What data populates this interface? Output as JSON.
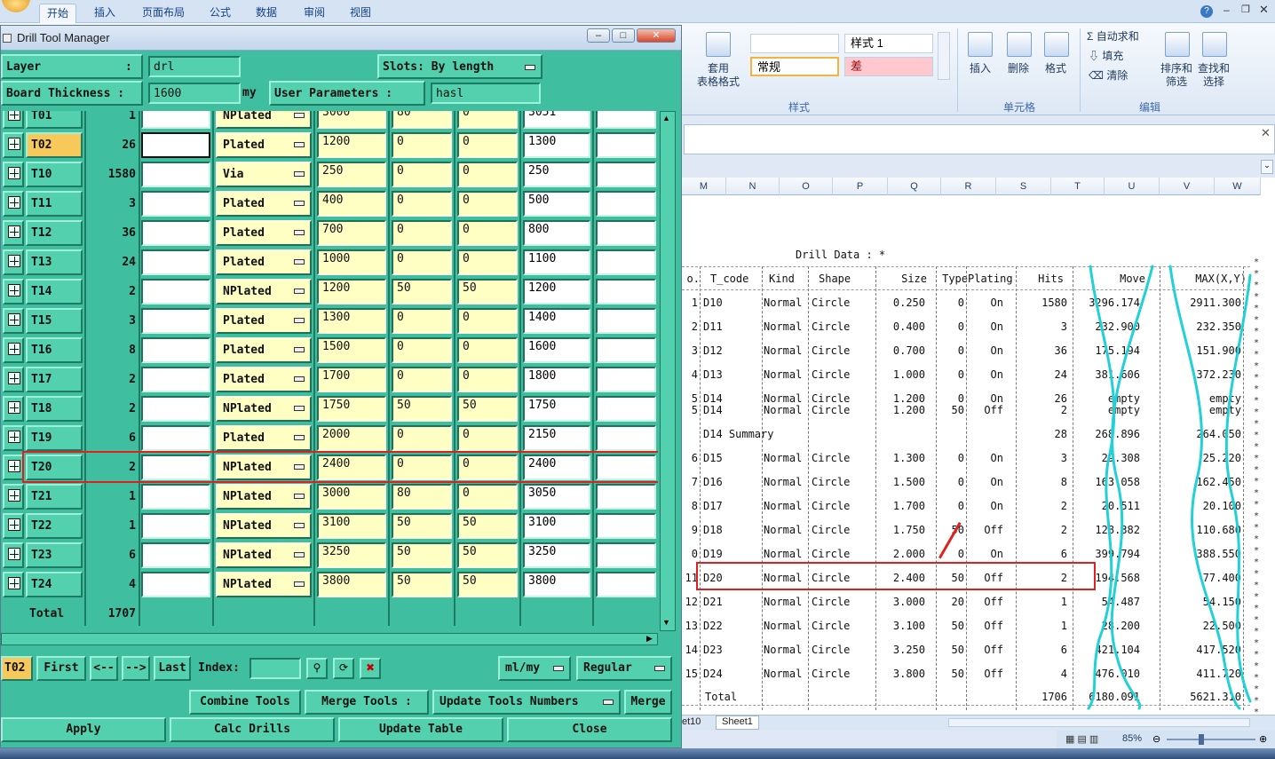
{
  "excel": {
    "tabs": [
      "开始",
      "插入",
      "页面布局",
      "公式",
      "数据",
      "审阅",
      "视图"
    ],
    "active_tab": "开始",
    "ribbon": {
      "style_labels": {
        "format_table": "套用\n表格格式",
        "style1": "样式 1",
        "normal": "常规",
        "bad": "差",
        "group_styles": "样式"
      },
      "cells_group": {
        "insert": "插入",
        "delete": "删除",
        "format": "格式",
        "label": "单元格"
      },
      "edit_group": {
        "autosum": "自动求和",
        "fill": "填充",
        "clear": "清除",
        "sort": "排序和\n筛选",
        "find": "查找和\n选择",
        "label": "编辑"
      }
    },
    "columns": [
      "M",
      "N",
      "O",
      "P",
      "Q",
      "R",
      "S",
      "T",
      "U",
      "V",
      "W"
    ],
    "sheet_tabs": [
      "et10",
      "Sheet1"
    ],
    "zoom": "85%",
    "drill_data": {
      "title": "Drill Data :  *",
      "headers": [
        "o.",
        "T_code",
        "Kind",
        "Shape",
        "Size",
        "Type",
        "Plating",
        "Hits",
        "Move",
        "MAX(X,Y)"
      ],
      "rows": [
        {
          "no": "1",
          "tcode": "D10",
          "kind": "Normal",
          "shape": "Circle",
          "size": "0.250",
          "type": "0",
          "plating": "On",
          "hits": "1580",
          "move": "3296.174",
          "max": "2911.300"
        },
        {
          "no": "2",
          "tcode": "D11",
          "kind": "Normal",
          "shape": "Circle",
          "size": "0.400",
          "type": "0",
          "plating": "On",
          "hits": "3",
          "move": "232.900",
          "max": "232.350"
        },
        {
          "no": "3",
          "tcode": "D12",
          "kind": "Normal",
          "shape": "Circle",
          "size": "0.700",
          "type": "0",
          "plating": "On",
          "hits": "36",
          "move": "175.194",
          "max": "151.900"
        },
        {
          "no": "4",
          "tcode": "D13",
          "kind": "Normal",
          "shape": "Circle",
          "size": "1.000",
          "type": "0",
          "plating": "On",
          "hits": "24",
          "move": "381.606",
          "max": "372.230"
        },
        {
          "no": "5",
          "tcode": "D14",
          "kind": "Normal",
          "shape": "Circle",
          "size": "1.200",
          "type": "0",
          "plating": "On",
          "hits": "26",
          "move": "empty",
          "max": "empty"
        },
        {
          "no": "5",
          "tcode": "D14",
          "kind": "Normal",
          "shape": "Circle",
          "size": "1.200",
          "type": "50",
          "plating": "Off",
          "hits": "2",
          "move": "empty",
          "max": "empty"
        },
        {
          "no": "",
          "tcode": "D14 Summary",
          "kind": "",
          "shape": "",
          "size": "",
          "type": "",
          "plating": "",
          "hits": "28",
          "move": "268.896",
          "max": "264.050"
        },
        {
          "no": "6",
          "tcode": "D15",
          "kind": "Normal",
          "shape": "Circle",
          "size": "1.300",
          "type": "0",
          "plating": "On",
          "hits": "3",
          "move": "29.308",
          "max": "25.220"
        },
        {
          "no": "7",
          "tcode": "D16",
          "kind": "Normal",
          "shape": "Circle",
          "size": "1.500",
          "type": "0",
          "plating": "On",
          "hits": "8",
          "move": "163.058",
          "max": "162.450"
        },
        {
          "no": "8",
          "tcode": "D17",
          "kind": "Normal",
          "shape": "Circle",
          "size": "1.700",
          "type": "0",
          "plating": "On",
          "hits": "2",
          "move": "20.511",
          "max": "20.100"
        },
        {
          "no": "9",
          "tcode": "D18",
          "kind": "Normal",
          "shape": "Circle",
          "size": "1.750",
          "type": "50",
          "plating": "Off",
          "hits": "2",
          "move": "128.382",
          "max": "110.680"
        },
        {
          "no": "0",
          "tcode": "D19",
          "kind": "Normal",
          "shape": "Circle",
          "size": "2.000",
          "type": "0",
          "plating": "On",
          "hits": "6",
          "move": "399.794",
          "max": "388.550"
        },
        {
          "no": "11",
          "tcode": "D20",
          "kind": "Normal",
          "shape": "Circle",
          "size": "2.400",
          "type": "50",
          "plating": "Off",
          "hits": "2",
          "move": "194.568",
          "max": "77.400"
        },
        {
          "no": "12",
          "tcode": "D21",
          "kind": "Normal",
          "shape": "Circle",
          "size": "3.000",
          "type": "20",
          "plating": "Off",
          "hits": "1",
          "move": "54.487",
          "max": "54.150"
        },
        {
          "no": "13",
          "tcode": "D22",
          "kind": "Normal",
          "shape": "Circle",
          "size": "3.100",
          "type": "50",
          "plating": "Off",
          "hits": "1",
          "move": "28.200",
          "max": "22.500"
        },
        {
          "no": "14",
          "tcode": "D23",
          "kind": "Normal",
          "shape": "Circle",
          "size": "3.250",
          "type": "50",
          "plating": "Off",
          "hits": "6",
          "move": "421.104",
          "max": "417.520"
        },
        {
          "no": "15",
          "tcode": "D24",
          "kind": "Normal",
          "shape": "Circle",
          "size": "3.800",
          "type": "50",
          "plating": "Off",
          "hits": "4",
          "move": "476.010",
          "max": "411.720"
        }
      ],
      "total_label": "Total",
      "total_hits": "1706",
      "total_move": "6180.091",
      "total_max": "5621.310"
    }
  },
  "dtm": {
    "title": "Drill Tool Manager",
    "layer_label": "Layer",
    "layer_colon": ":",
    "layer_value": "drl",
    "slots_label": "Slots:",
    "slots_value": "By length",
    "board_label": "Board Thickness :",
    "board_value": "1600",
    "board_unit": "my",
    "user_params_label": "User Parameters :",
    "user_params_value": "hasl",
    "tools": [
      {
        "code": "T01",
        "hits": "1",
        "plating": "NPlated",
        "a": "3000",
        "b": "80",
        "c": "0",
        "d": "3051"
      },
      {
        "code": "T02",
        "hits": "26",
        "plating": "Plated",
        "a": "1200",
        "b": "0",
        "c": "0",
        "d": "1300",
        "selected": true
      },
      {
        "code": "T10",
        "hits": "1580",
        "plating": "Via",
        "a": "250",
        "b": "0",
        "c": "0",
        "d": "250"
      },
      {
        "code": "T11",
        "hits": "3",
        "plating": "Plated",
        "a": "400",
        "b": "0",
        "c": "0",
        "d": "500"
      },
      {
        "code": "T12",
        "hits": "36",
        "plating": "Plated",
        "a": "700",
        "b": "0",
        "c": "0",
        "d": "800"
      },
      {
        "code": "T13",
        "hits": "24",
        "plating": "Plated",
        "a": "1000",
        "b": "0",
        "c": "0",
        "d": "1100"
      },
      {
        "code": "T14",
        "hits": "2",
        "plating": "NPlated",
        "a": "1200",
        "b": "50",
        "c": "50",
        "d": "1200"
      },
      {
        "code": "T15",
        "hits": "3",
        "plating": "Plated",
        "a": "1300",
        "b": "0",
        "c": "0",
        "d": "1400"
      },
      {
        "code": "T16",
        "hits": "8",
        "plating": "Plated",
        "a": "1500",
        "b": "0",
        "c": "0",
        "d": "1600"
      },
      {
        "code": "T17",
        "hits": "2",
        "plating": "Plated",
        "a": "1700",
        "b": "0",
        "c": "0",
        "d": "1800"
      },
      {
        "code": "T18",
        "hits": "2",
        "plating": "NPlated",
        "a": "1750",
        "b": "50",
        "c": "50",
        "d": "1750"
      },
      {
        "code": "T19",
        "hits": "6",
        "plating": "Plated",
        "a": "2000",
        "b": "0",
        "c": "0",
        "d": "2150"
      },
      {
        "code": "T20",
        "hits": "2",
        "plating": "NPlated",
        "a": "2400",
        "b": "0",
        "c": "0",
        "d": "2400"
      },
      {
        "code": "T21",
        "hits": "1",
        "plating": "NPlated",
        "a": "3000",
        "b": "80",
        "c": "0",
        "d": "3050"
      },
      {
        "code": "T22",
        "hits": "1",
        "plating": "NPlated",
        "a": "3100",
        "b": "50",
        "c": "50",
        "d": "3100"
      },
      {
        "code": "T23",
        "hits": "6",
        "plating": "NPlated",
        "a": "3250",
        "b": "50",
        "c": "50",
        "d": "3250"
      },
      {
        "code": "T24",
        "hits": "4",
        "plating": "NPlated",
        "a": "3800",
        "b": "50",
        "c": "50",
        "d": "3800"
      }
    ],
    "total_label": "Total",
    "total_hits": "1707",
    "nav": {
      "current": "T02",
      "first": "First",
      "prev": "<--",
      "next": "-->",
      "last": "Last",
      "index_label": "Index:",
      "unit": "ml/my",
      "mode": "Regular"
    },
    "actions": {
      "combine": "Combine Tools",
      "merge_label": "Merge Tools :",
      "update_numbers": "Update Tools Numbers",
      "merge": "Merge",
      "apply": "Apply",
      "calc": "Calc Drills",
      "update_table": "Update Table",
      "close": "Close"
    }
  }
}
